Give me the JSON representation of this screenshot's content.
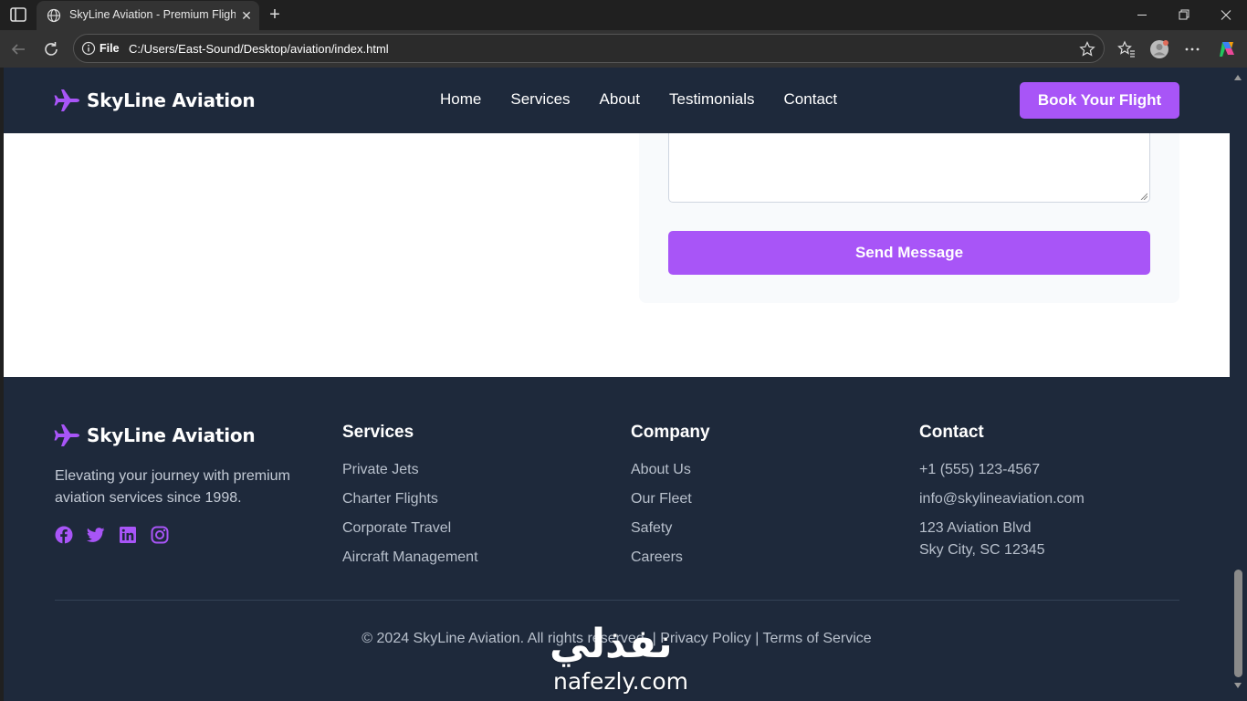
{
  "browser": {
    "tab_title": "SkyLine Aviation - Premium Flight",
    "address_scheme": "File",
    "address_url": "C:/Users/East-Sound/Desktop/aviation/index.html"
  },
  "nav": {
    "brand": "SkyLine Aviation",
    "links": [
      "Home",
      "Services",
      "About",
      "Testimonials",
      "Contact"
    ],
    "cta": "Book Your Flight"
  },
  "contact_form": {
    "submit_label": "Send Message"
  },
  "footer": {
    "brand": "SkyLine Aviation",
    "description": "Elevating your journey with premium aviation services since 1998.",
    "socials": [
      "facebook-icon",
      "twitter-icon",
      "linkedin-icon",
      "instagram-icon"
    ],
    "services": {
      "heading": "Services",
      "items": [
        "Private Jets",
        "Charter Flights",
        "Corporate Travel",
        "Aircraft Management"
      ]
    },
    "company": {
      "heading": "Company",
      "items": [
        "About Us",
        "Our Fleet",
        "Safety",
        "Careers"
      ]
    },
    "contact": {
      "heading": "Contact",
      "phone": "+1 (555) 123-4567",
      "email": "info@skylineaviation.com",
      "address_line1": "123 Aviation Blvd",
      "address_line2": "Sky City, SC 12345"
    },
    "copyright": "© 2024 SkyLine Aviation. All rights reserved. | Privacy Policy | Terms of Service"
  },
  "watermark": {
    "arabic": "نفذلي",
    "latin": "nafezly.com"
  },
  "colors": {
    "accent": "#a855f7",
    "dark": "#1e293b"
  }
}
